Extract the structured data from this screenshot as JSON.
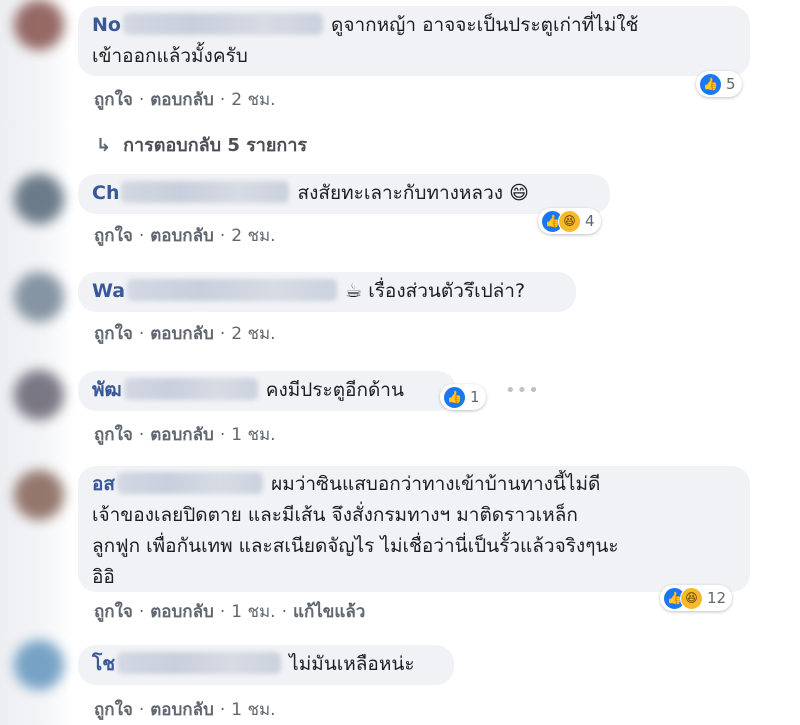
{
  "comments": [
    {
      "author": "No",
      "lines": [
        "ดูจากหญ้า อาจจะเป็นประตูเก่าที่ไม่ใช้",
        "เข้าออกแล้วมั้งครับ"
      ],
      "like": "ถูกใจ",
      "reply": "ตอบกลับ",
      "time": "2 ชม.",
      "reaction_count": "5"
    },
    {
      "author": "Ch",
      "lines": [
        "สงสัยทะเลาะกับทางหลวง 😄"
      ],
      "like": "ถูกใจ",
      "reply": "ตอบกลับ",
      "time": "2 ชม.",
      "reaction_count": "4"
    },
    {
      "author": "Wa",
      "lines": [
        "☕ เรื่องส่วนตัวรึเปล่า?"
      ],
      "like": "ถูกใจ",
      "reply": "ตอบกลับ",
      "time": "2 ชม."
    },
    {
      "author": "พัฒ",
      "lines": [
        "คงมีประตูอีกด้าน"
      ],
      "like": "ถูกใจ",
      "reply": "ตอบกลับ",
      "time": "1 ชม.",
      "reaction_count": "1"
    },
    {
      "author": "อส",
      "lines": [
        "ผมว่าซินแสบอกว่าทางเข้าบ้านทางนี้ไม่ดี",
        "เจ้าของเลยปิดตาย และมีเส้น จึงสั่งกรมทางฯ มาติดราวเหล็ก",
        "ลูกฟูก เพื่อกันเทพ และสเนียดจัญไร ไม่เชื่อว่านี่เป็นรั้วแล้วจริงๆนะ",
        "อิอิ"
      ],
      "like": "ถูกใจ",
      "reply": "ตอบกลับ",
      "time": "1 ชม.",
      "edited": "แก้ไขแล้ว",
      "reaction_count": "12"
    },
    {
      "author": "โช",
      "lines": [
        "ไม่มันเหลือหน่ะ"
      ],
      "like": "ถูกใจ",
      "reply": "ตอบกลับ",
      "time": "1 ชม."
    }
  ],
  "replies_link": "การตอบกลับ 5 รายการ",
  "icons": {
    "like": "like-icon",
    "haha": "haha-icon",
    "reply_arrow": "reply-arrow-icon",
    "more": "more-options-icon"
  },
  "colors": {
    "bubble": "#f0f2f5",
    "author": "#385898",
    "like_blue": "#1877f2"
  }
}
